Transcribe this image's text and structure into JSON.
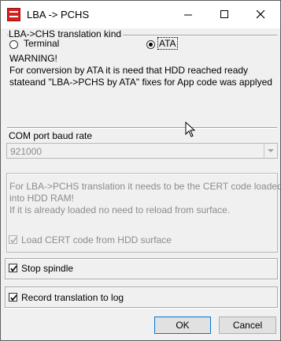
{
  "window": {
    "title": "LBA -> PCHS"
  },
  "translation_kind": {
    "legend": "LBA->CHS translation kind",
    "options": [
      {
        "label": "Terminal",
        "selected": false
      },
      {
        "label": "ATA",
        "selected": true
      }
    ],
    "warning_title": "WARNING!",
    "warning_line1": "For conversion by ATA it is need that HDD reached ready",
    "warning_line2": "stateand \"LBA->PCHS by ATA\" fixes for App code was applyed"
  },
  "com_port": {
    "legend": "COM port baud rate",
    "value": "921000"
  },
  "cert": {
    "line1": "For LBA->PCHS translation it needs to be the CERT code loaded",
    "line2": "into HDD RAM!",
    "line3": "If it is already loaded no need to reload from surface.",
    "load_label": "Load CERT code from HDD surface",
    "load_checked": true
  },
  "stop_spindle": {
    "label": "Stop spindle",
    "checked": true
  },
  "record_log": {
    "label": "Record translation to log",
    "checked": true
  },
  "buttons": {
    "ok": "OK",
    "cancel": "Cancel"
  }
}
